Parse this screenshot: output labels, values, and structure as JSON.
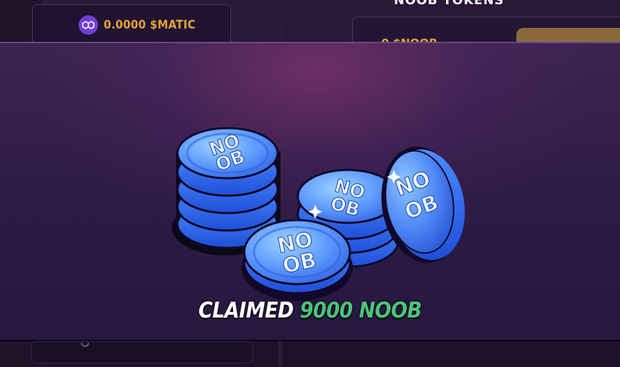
{
  "wallet": {
    "balance": "0.0000 $MATIC",
    "icon": "polygon-icon"
  },
  "tokens": {
    "title": "NOOB TOKENS",
    "amount": "0 $NOOB"
  },
  "modal": {
    "claimed_label": "CLAIMED",
    "claimed_amount": "9000 NOOB",
    "coin_label": "NO OB"
  },
  "colors": {
    "accent_gold": "#e3a23a",
    "success_green": "#4cc27a",
    "coin_blue": "#3d7bff"
  }
}
